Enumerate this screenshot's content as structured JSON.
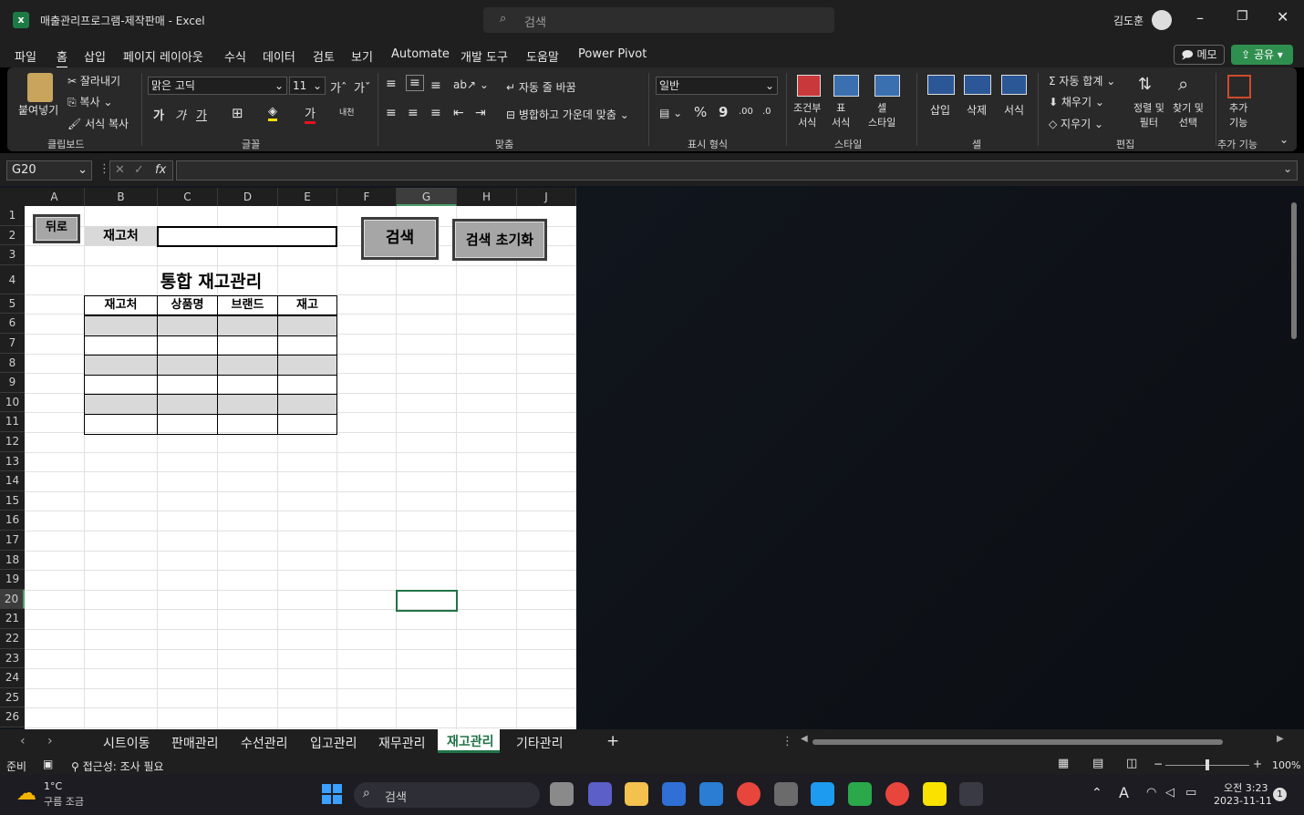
{
  "window": {
    "title": "매출관리프로그램-제작판매  -  Excel",
    "search_placeholder": "검색",
    "user_name": "김도훈",
    "memo_label": "메모",
    "share_label": "공유"
  },
  "ribbon_tabs": [
    "파일",
    "홈",
    "삽입",
    "페이지 레이아웃",
    "수식",
    "데이터",
    "검토",
    "보기",
    "Automate",
    "개발 도구",
    "도움말",
    "Power Pivot"
  ],
  "ribbon": {
    "clipboard": {
      "paste": "붙여넣기",
      "cut": "잘라내기",
      "copy": "복사",
      "format_painter": "서식 복사",
      "group": "클립보드"
    },
    "font": {
      "name": "맑은 고딕",
      "size": "11",
      "group": "글꼴",
      "bold": "가",
      "italic": "가",
      "underline": "가",
      "font_color": "가",
      "phonetic": "내천"
    },
    "align": {
      "wrap": "자동 줄 바꿈",
      "merge": "병합하고 가운데 맞춤",
      "group": "맞춤"
    },
    "number": {
      "format": "일반",
      "group": "표시 형식",
      "percent": "%",
      "comma": "9"
    },
    "styles": {
      "conditional": "조건부\n서식",
      "table": "표\n서식",
      "cell_style": "셀\n스타일",
      "group": "스타일"
    },
    "cells": {
      "insert": "삽입",
      "delete": "삭제",
      "format": "서식",
      "group": "셀"
    },
    "editing": {
      "autosum": "자동 합계",
      "fill": "채우기",
      "clear": "지우기",
      "sort": "정렬 및\n필터",
      "find": "찾기 및\n선택",
      "group": "편집"
    },
    "addins": {
      "label": "추가\n기능",
      "group": "추가 기능"
    }
  },
  "formula_bar": {
    "name_box": "G20",
    "fx": "fx",
    "formula": ""
  },
  "columns": [
    "A",
    "B",
    "C",
    "D",
    "E",
    "F",
    "G",
    "H",
    "J"
  ],
  "rows": [
    "1",
    "2",
    "3",
    "4",
    "5",
    "6",
    "7",
    "8",
    "9",
    "10",
    "11",
    "12",
    "13",
    "14",
    "15",
    "16",
    "17",
    "18",
    "19",
    "20",
    "21",
    "22",
    "23",
    "24",
    "25",
    "26"
  ],
  "sheet": {
    "back_button": "뒤로",
    "location_label": "재고처",
    "location_value": "",
    "search_button": "검색",
    "reset_button": "검색 초기화",
    "title": "통합 재고관리",
    "table_headers": [
      "재고처",
      "상품명",
      "브랜드",
      "재고"
    ]
  },
  "sheet_tabs": [
    "시트이동",
    "판매관리",
    "수선관리",
    "입고관리",
    "재무관리",
    "재고관리",
    "기타관리"
  ],
  "active_sheet": "재고관리",
  "status": {
    "ready": "준비",
    "accessibility": "접근성: 조사 필요",
    "zoom": "100%"
  },
  "taskbar": {
    "temp": "1°C",
    "weather": "구름 조금",
    "search": "검색",
    "time": "오전 3:23",
    "date": "2023-11-11",
    "notif": "1"
  }
}
